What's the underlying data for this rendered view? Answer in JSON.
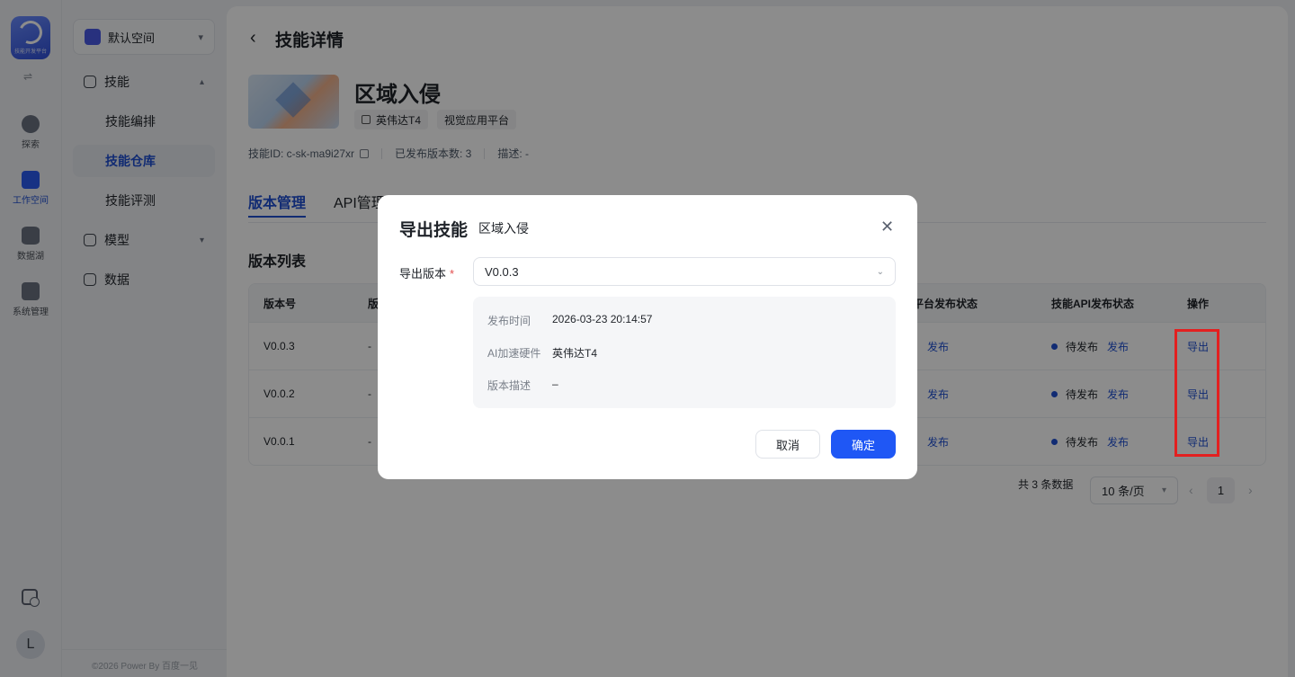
{
  "rail": {
    "logo_sub": "技能开发平台",
    "items": [
      {
        "label": "探索"
      },
      {
        "label": "工作空间"
      },
      {
        "label": "数据湖"
      },
      {
        "label": "系统管理"
      }
    ],
    "avatar": "L"
  },
  "sidebar": {
    "space": "默认空间",
    "skills": "技能",
    "sub": [
      "技能编排",
      "技能仓库",
      "技能评测"
    ],
    "model": "模型",
    "data": "数据",
    "copyright": "©2026 Power By 百度一见"
  },
  "page": {
    "title": "技能详情",
    "skill_name": "区域入侵",
    "tags": [
      "英伟达T4",
      "视觉应用平台"
    ],
    "skill_id": "技能ID:  c-sk-ma9i27xr",
    "published_count": "已发布版本数:  3",
    "description": "描述:  -",
    "tabs": [
      "版本管理",
      "API管理"
    ],
    "section_title": "版本列表"
  },
  "table": {
    "headers": {
      "version": "版本号",
      "col2": "版",
      "platform_status": "平台发布状态",
      "api_status": "技能API发布状态",
      "action": "操作"
    },
    "rows": [
      {
        "version": "V0.0.3",
        "col2": "-",
        "platform_link": "发布",
        "api_status": "待发布",
        "api_link": "发布",
        "action": "导出"
      },
      {
        "version": "V0.0.2",
        "col2": "-",
        "platform_link": "发布",
        "api_status": "待发布",
        "api_link": "发布",
        "action": "导出"
      },
      {
        "version": "V0.0.1",
        "col2": "-",
        "platform_link": "发布",
        "api_status": "待发布",
        "api_link": "发布",
        "action": "导出"
      }
    ]
  },
  "pager": {
    "total": "共 3 条数据",
    "size": "10 条/页",
    "current": "1"
  },
  "modal": {
    "title": "导出技能",
    "subtitle": "区域入侵",
    "version_label": "导出版本",
    "version_value": "V0.0.3",
    "info": [
      {
        "k": "发布时间",
        "v": "2026-03-23 20:14:57"
      },
      {
        "k": "AI加速硬件",
        "v": "英伟达T4"
      },
      {
        "k": "版本描述",
        "v": "–"
      }
    ],
    "cancel": "取消",
    "confirm": "确定"
  },
  "colors": {
    "accent": "#1f57f5",
    "highlight_box": "#e32020"
  }
}
